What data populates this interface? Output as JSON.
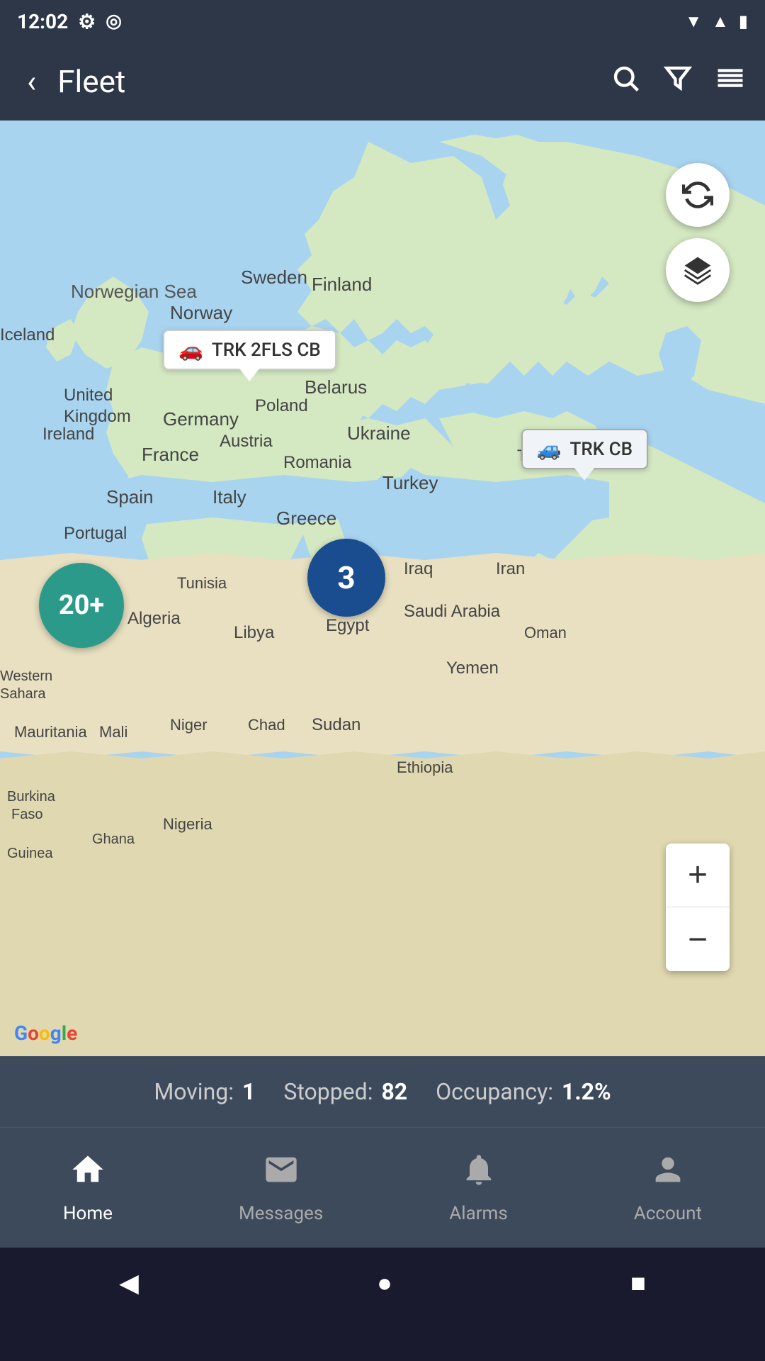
{
  "statusBar": {
    "time": "12:02",
    "icons": [
      "settings",
      "at-sign",
      "wifi",
      "signal",
      "battery"
    ]
  },
  "topNav": {
    "back": "‹",
    "title": "Fleet",
    "searchIcon": "🔍",
    "filterIcon": "⊽",
    "menuIcon": "☰"
  },
  "map": {
    "refreshIcon": "↻",
    "layersIcon": "◆",
    "markers": [
      {
        "id": "trk2fls",
        "label": "TRK 2FLS CB",
        "type": "car"
      },
      {
        "id": "trkcb",
        "label": "TRK CB",
        "type": "car-outline"
      }
    ],
    "clusters": [
      {
        "id": "cluster-large",
        "value": "20+"
      },
      {
        "id": "cluster-small",
        "value": "3"
      }
    ],
    "zoomIn": "+",
    "zoomOut": "−",
    "googleLogo": "Google"
  },
  "statsBar": {
    "movingLabel": "Moving:",
    "movingValue": "1",
    "stoppedLabel": "Stopped:",
    "stoppedValue": "82",
    "occupancyLabel": "Occupancy:",
    "occupancyValue": "1.2%"
  },
  "bottomNav": {
    "items": [
      {
        "id": "home",
        "label": "Home",
        "icon": "🏠",
        "active": true
      },
      {
        "id": "messages",
        "label": "Messages",
        "icon": "✉",
        "active": false
      },
      {
        "id": "alarms",
        "label": "Alarms",
        "icon": "🔔",
        "active": false
      },
      {
        "id": "account",
        "label": "Account",
        "icon": "👤",
        "active": false
      }
    ]
  },
  "systemNav": {
    "back": "◀",
    "home": "●",
    "recent": "■"
  }
}
